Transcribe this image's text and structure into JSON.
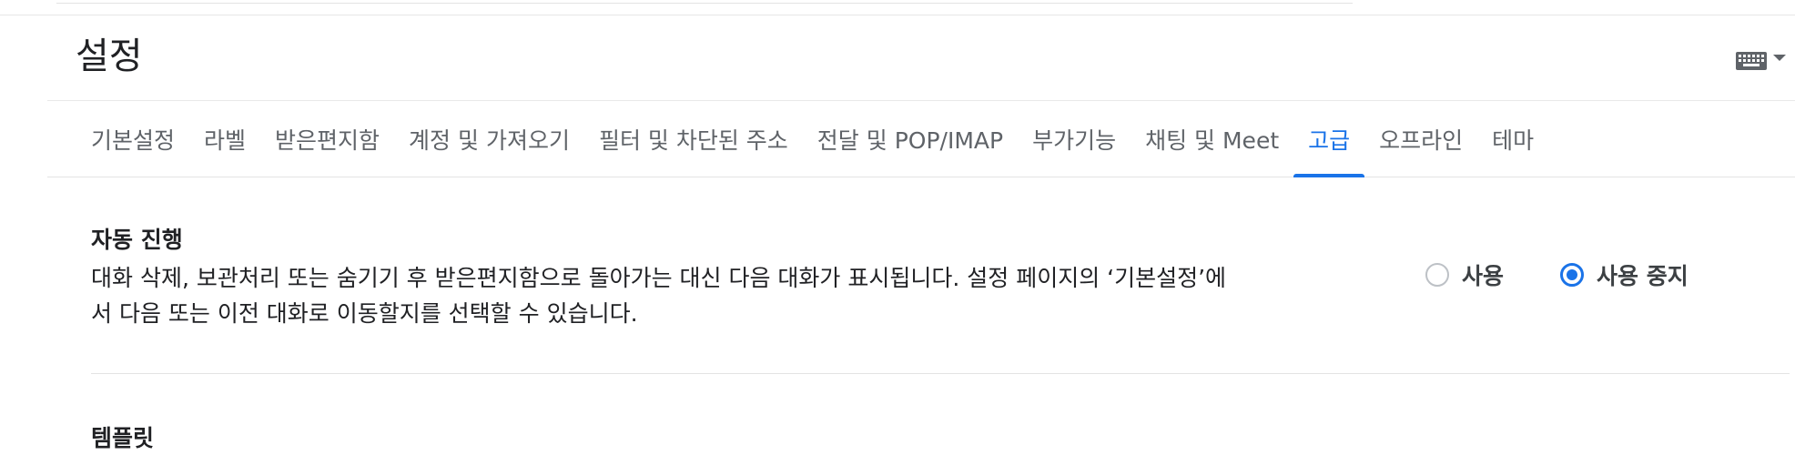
{
  "page": {
    "title": "설정"
  },
  "toolbar": {
    "keyboard_icon": "keyboard-icon",
    "dropdown_icon": "caret-down-icon"
  },
  "tabs": [
    {
      "label": "기본설정",
      "active": false
    },
    {
      "label": "라벨",
      "active": false
    },
    {
      "label": "받은편지함",
      "active": false
    },
    {
      "label": "계정 및 가져오기",
      "active": false
    },
    {
      "label": "필터 및 차단된 주소",
      "active": false
    },
    {
      "label": "전달 및 POP/IMAP",
      "active": false
    },
    {
      "label": "부가기능",
      "active": false
    },
    {
      "label": "채팅 및 Meet",
      "active": false
    },
    {
      "label": "고급",
      "active": true
    },
    {
      "label": "오프라인",
      "active": false
    },
    {
      "label": "테마",
      "active": false
    }
  ],
  "auto_advance": {
    "title": "자동 진행",
    "description": "대화 삭제, 보관처리 또는 숨기기 후 받은편지함으로 돌아가는 대신 다음 대화가 표시됩니다. 설정 페이지의 ‘기본설정’에서 다음 또는 이전 대화로 이동할지를 선택할 수 있습니다.",
    "options": [
      {
        "label": "사용",
        "checked": false
      },
      {
        "label": "사용 중지",
        "checked": true
      }
    ]
  },
  "templates": {
    "title": "템플릿"
  },
  "colors": {
    "accent": "#1a73e8",
    "tab_text": "#5f6368",
    "text": "#202124"
  }
}
